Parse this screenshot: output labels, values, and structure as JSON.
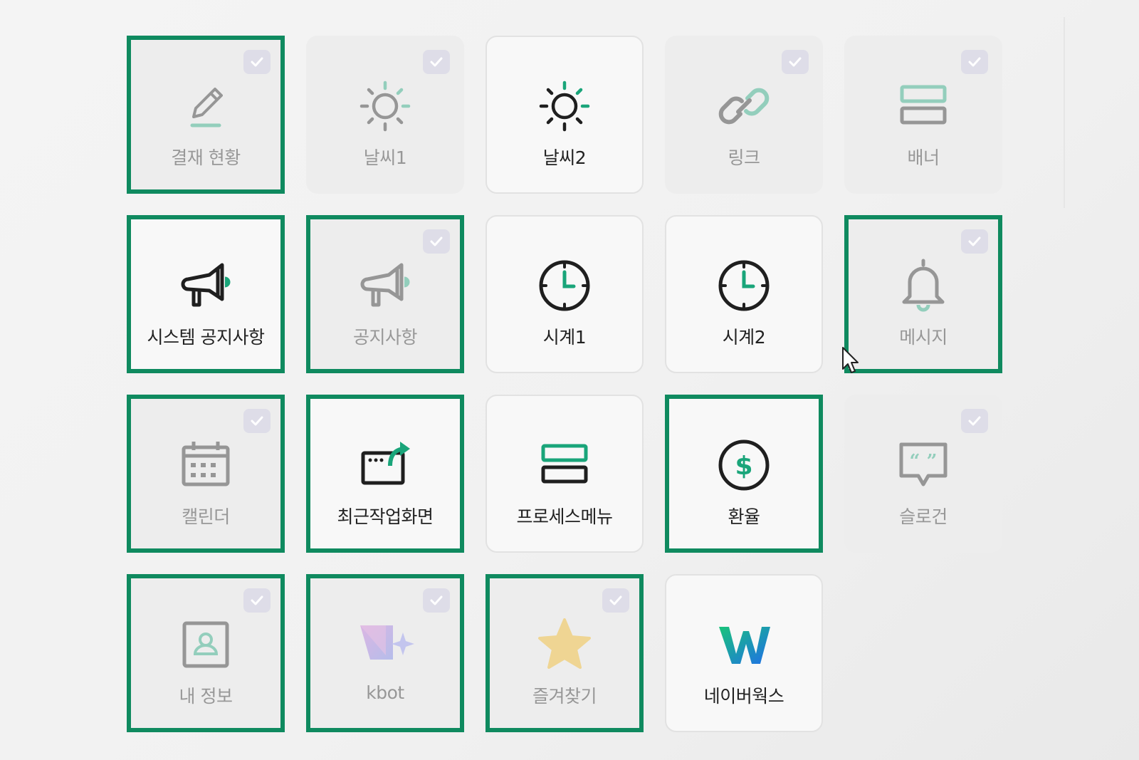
{
  "tiles": [
    {
      "label": "결재 현황",
      "icon": "pencil-icon",
      "enabled": false,
      "highlight": true,
      "checked": true
    },
    {
      "label": "날씨1",
      "icon": "sun-icon",
      "enabled": false,
      "highlight": false,
      "checked": true
    },
    {
      "label": "날씨2",
      "icon": "sun-icon",
      "enabled": true,
      "highlight": false,
      "checked": false
    },
    {
      "label": "링크",
      "icon": "link-icon",
      "enabled": false,
      "highlight": false,
      "checked": true
    },
    {
      "label": "배너",
      "icon": "banner-icon",
      "enabled": false,
      "highlight": false,
      "checked": true
    },
    {
      "label": "시스템 공지사항",
      "icon": "megaphone-icon",
      "enabled": true,
      "highlight": true,
      "checked": false
    },
    {
      "label": "공지사항",
      "icon": "megaphone-icon",
      "enabled": false,
      "highlight": true,
      "checked": true
    },
    {
      "label": "시계1",
      "icon": "clock-icon",
      "enabled": true,
      "highlight": false,
      "checked": false
    },
    {
      "label": "시계2",
      "icon": "clock-icon",
      "enabled": true,
      "highlight": false,
      "checked": false
    },
    {
      "label": "메시지",
      "icon": "bell-icon",
      "enabled": false,
      "highlight": true,
      "checked": true
    },
    {
      "label": "캘린더",
      "icon": "calendar-icon",
      "enabled": false,
      "highlight": true,
      "checked": true
    },
    {
      "label": "최근작업화면",
      "icon": "recent-window-icon",
      "enabled": true,
      "highlight": true,
      "checked": false
    },
    {
      "label": "프로세스메뉴",
      "icon": "process-menu-icon",
      "enabled": true,
      "highlight": false,
      "checked": false
    },
    {
      "label": "환율",
      "icon": "dollar-icon",
      "enabled": true,
      "highlight": true,
      "checked": false
    },
    {
      "label": "슬로건",
      "icon": "quote-bubble-icon",
      "enabled": false,
      "highlight": false,
      "checked": true
    },
    {
      "label": "내 정보",
      "icon": "profile-icon",
      "enabled": false,
      "highlight": true,
      "checked": true
    },
    {
      "label": "kbot",
      "icon": "kbot-icon",
      "enabled": false,
      "highlight": true,
      "checked": true
    },
    {
      "label": "즐겨찾기",
      "icon": "star-icon",
      "enabled": false,
      "highlight": true,
      "checked": true
    },
    {
      "label": "네이버웍스",
      "icon": "naver-works-icon",
      "enabled": true,
      "highlight": false,
      "checked": false
    }
  ],
  "colors": {
    "accent": "#0f8a5f",
    "icon_dark": "#1f1f1f",
    "icon_green": "#1aa57a",
    "check_bg": "#dedde8"
  }
}
